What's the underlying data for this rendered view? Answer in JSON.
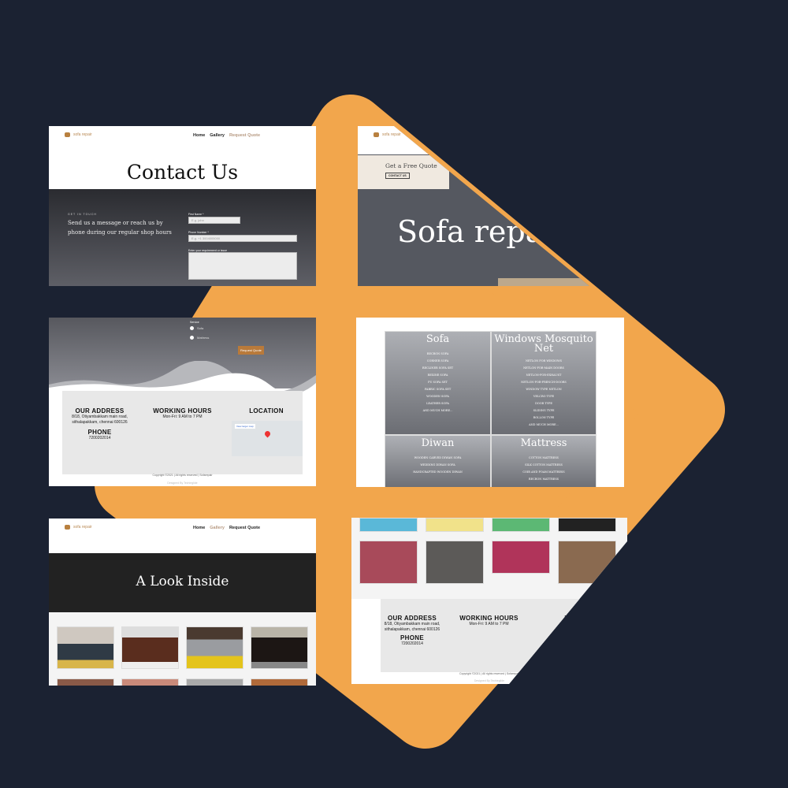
{
  "brand": {
    "logo_text": "sofa repair"
  },
  "colors": {
    "background": "#1b2232",
    "accent_shape": "#f2a64c",
    "button": "#b97a3a"
  },
  "nav": {
    "home": "Home",
    "gallery": "Gallery",
    "request_quote": "Request Quote"
  },
  "contact": {
    "title": "Contact Us",
    "eyebrow": "GET IN TOUCH",
    "message": "Send us a message or reach us by phone during our regular shop hours",
    "first_name_label": "First Name *",
    "first_name_placeholder": "E.g. john",
    "phone_label": "Phone Number *",
    "phone_placeholder": "E.g. +1 3004005000",
    "requirement_label": "Enter your requirement or issue"
  },
  "hero": {
    "quote_heading": "Get a Free Quote",
    "contact_button": "CONTACT US",
    "title": "Sofa repair"
  },
  "form2": {
    "service_label": "Service",
    "options": [
      "Sofa",
      "Mattress"
    ],
    "submit": "Request Quote"
  },
  "footer": {
    "address_heading": "OUR ADDRESS",
    "address": "8/18, Otiyambakkam main road, sithalapakkam, chennai 600126",
    "hours_heading": "WORKING HOURS",
    "hours": "Mon-Fri: 9 AM to 7 PM",
    "location_heading": "LOCATION",
    "phone_heading": "PHONE",
    "phone": "7200202014",
    "map_link": "View larger map",
    "copyright": "Copyright ©2021 | All rights reserved | Sofarepair",
    "designed_by": "Designed By Techieglide"
  },
  "services": [
    {
      "title": "Sofa",
      "items": [
        "RECRON SOFA",
        "CORNER SOFA",
        "RECLINER SOFA SET",
        "REXINE SOFA",
        "PU SOFA SET",
        "FABRIC SOFA SET",
        "WOODEN SOFA",
        "LEATHER SOFA",
        "AND MUCH MORE..."
      ]
    },
    {
      "title": "Windows Mosquito Net",
      "items": [
        "NETLON FOR WINDOWS",
        "NETLON-FOR-MAIN DOORS",
        "NETLON-FOR-EXHAUST",
        "NETLON-FOR-FRENCH-DOORS",
        "WINDOW TYPE NETLON",
        "VELCRO TYPE",
        "DOOR TYPE",
        "SLIDING TYPE",
        "ROLLON TYPE",
        "AND MUCH MORE..."
      ]
    },
    {
      "title": "Diwan",
      "items": [
        "WOODEN CARVED DIWAN SOFA",
        "WEDDING DIWAN SOFA",
        "HANDCRAFTED WOODEN DIWAN"
      ]
    },
    {
      "title": "Mattress",
      "items": [
        "COTTON MATTRESS",
        "SILK COTTON MATTRESS",
        "COIR AND FOAM MATTRESS",
        "RECRON MATTRESS"
      ]
    }
  ],
  "gallery": {
    "title": "A Look Inside"
  }
}
